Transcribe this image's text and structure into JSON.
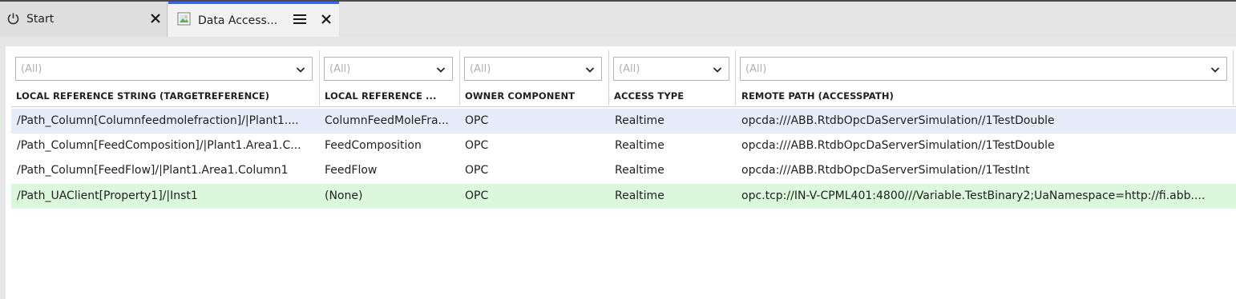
{
  "tabs": [
    {
      "label": "Start",
      "icon": "power-icon",
      "close": "✕"
    },
    {
      "label": "Data Access...",
      "icon": "image-icon",
      "menu": "≡",
      "close": "✕",
      "accent": "#3366ff"
    }
  ],
  "filters": [
    "(All)",
    "(All)",
    "(All)",
    "(All)",
    "(All)"
  ],
  "columns": [
    "LOCAL REFERENCE STRING (TARGETREFERENCE)",
    "LOCAL REFERENCE ...",
    "OWNER COMPONENT",
    "ACCESS TYPE",
    "REMOTE PATH (ACCESSPATH)"
  ],
  "rows": [
    {
      "cells": [
        "/Path_Column[Columnfeedmolefraction]/|Plant1....",
        "ColumnFeedMoleFra...",
        "OPC",
        "Realtime",
        "opcda:///ABB.RtdbOpcDaServerSimulation//1TestDouble"
      ],
      "state": "selected",
      "color": "#e6ecfa"
    },
    {
      "cells": [
        "/Path_Column[FeedComposition]/|Plant1.Area1.C...",
        "FeedComposition",
        "OPC",
        "Realtime",
        "opcda:///ABB.RtdbOpcDaServerSimulation//1TestDouble"
      ],
      "state": "normal",
      "color": "#ffffff"
    },
    {
      "cells": [
        "/Path_Column[FeedFlow]/|Plant1.Area1.Column1",
        "FeedFlow",
        "OPC",
        "Realtime",
        "opcda:///ABB.RtdbOpcDaServerSimulation//1TestInt"
      ],
      "state": "normal",
      "color": "#ffffff"
    },
    {
      "cells": [
        "/Path_UAClient[Property1]/|Inst1",
        "(None)",
        "OPC",
        "Realtime",
        "opc.tcp://IN-V-CPML401:4800///Variable.TestBinary2;UaNamespace=http://fi.abb...."
      ],
      "state": "highlighted",
      "color": "#dcf8dc"
    }
  ]
}
